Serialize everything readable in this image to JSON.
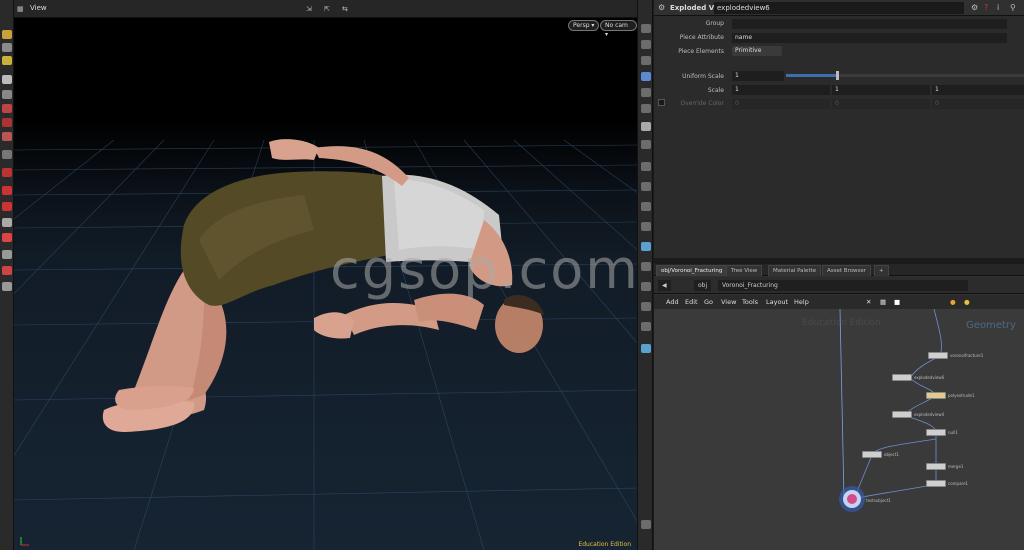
{
  "viewport": {
    "title": "View",
    "persp_label": "Persp ▾",
    "cam_label": "No cam ▾",
    "watermark": "cgsop.com",
    "edu_label": "Education Edition"
  },
  "params": {
    "node_type": "Exploded View",
    "node_name": "explodedview6",
    "group_label": "Group",
    "group_value": "",
    "piece_attr_label": "Piece Attribute",
    "piece_attr_value": "name",
    "piece_elements_label": "Piece Elements",
    "piece_elements_value": "Primitive",
    "uniform_scale_label": "Uniform Scale",
    "uniform_scale_value": "1",
    "uniform_scale_fraction": 0.21,
    "scale_label": "Scale",
    "scale_values": [
      "1",
      "1",
      "1"
    ],
    "override_color_label": "Override Color",
    "override_color_values": [
      "0",
      "0",
      "0"
    ]
  },
  "network": {
    "tabs": [
      "obj/Voronoi_Fracturing",
      "Tree View",
      "Material Palette",
      "Asset Browser",
      "+"
    ],
    "path": [
      "obj",
      "Voronoi_Fracturing"
    ],
    "menu": [
      "Add",
      "Edit",
      "Go",
      "View",
      "Tools",
      "Layout",
      "Help"
    ],
    "edu_label": "Education Edition",
    "context_label": "Geometry",
    "nodes": [
      {
        "label": "voronoifracture1"
      },
      {
        "label": "explodedview6"
      },
      {
        "label": "polyextrude1"
      },
      {
        "label": "explodedview4"
      },
      {
        "label": "null1"
      },
      {
        "label": "merge1"
      },
      {
        "label": "object1"
      },
      {
        "label": "compare1"
      },
      {
        "label": "testsubject1"
      }
    ]
  }
}
